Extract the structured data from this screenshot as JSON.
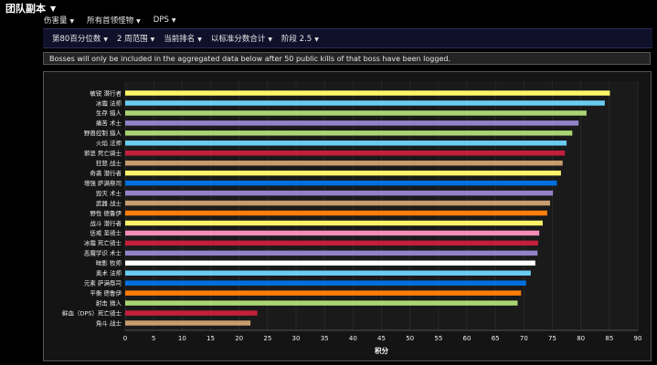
{
  "header": {
    "title": "团队副本"
  },
  "filters_row1": [
    "伤害量",
    "所有首领怪物",
    "DPS"
  ],
  "filters_row2": [
    "第80百分位数",
    "2 周范围",
    "当前排名",
    "以标准分数合计",
    "阶段 2.5"
  ],
  "notice": "Bosses will only be included in the aggregated data below after 50 public kills of that boss have been logged.",
  "chart_data": {
    "type": "bar",
    "orientation": "horizontal",
    "categories": [
      "敏锐 潜行者",
      "冰霜 法师",
      "生存 猎人",
      "痛苦 术士",
      "野兽控制 猎人",
      "火焰 法师",
      "邪恶 死亡骑士",
      "狂怒 战士",
      "奇袭 潜行者",
      "增强 萨满祭司",
      "毁灭 术士",
      "武器 战士",
      "野性 德鲁伊",
      "战斗 潜行者",
      "惩戒 圣骑士",
      "冰霜 死亡骑士",
      "恶魔学识 术士",
      "暗影 牧师",
      "奥术 法师",
      "元素 萨满祭司",
      "平衡 德鲁伊",
      "射击 猎人",
      "鲜血（DPS）死亡骑士",
      "角斗 战士"
    ],
    "values": [
      85.1,
      84.2,
      81.0,
      79.6,
      78.5,
      77.5,
      77.2,
      76.8,
      76.5,
      75.8,
      75.1,
      74.6,
      74.1,
      73.3,
      72.7,
      72.5,
      72.4,
      72.0,
      71.2,
      70.4,
      69.5,
      68.9,
      23.2,
      22.0
    ],
    "colors": [
      "#fff569",
      "#69ccf0",
      "#abd473",
      "#9482c9",
      "#abd473",
      "#69ccf0",
      "#c41f3b",
      "#c79c6e",
      "#fff569",
      "#0070de",
      "#9482c9",
      "#c79c6e",
      "#ff7d0a",
      "#fff569",
      "#f58cba",
      "#c41f3b",
      "#9482c9",
      "#ffffff",
      "#69ccf0",
      "#0070de",
      "#ff7d0a",
      "#abd473",
      "#c41f3b",
      "#c79c6e"
    ],
    "xlim": [
      0,
      90
    ],
    "xticks": [
      "0",
      "5",
      "10",
      "15",
      "20",
      "25",
      "30",
      "35",
      "40",
      "45",
      "50",
      "55",
      "60",
      "65",
      "70",
      "75",
      "80",
      "85",
      "90"
    ],
    "xlabel": "积分",
    "grid": true
  }
}
